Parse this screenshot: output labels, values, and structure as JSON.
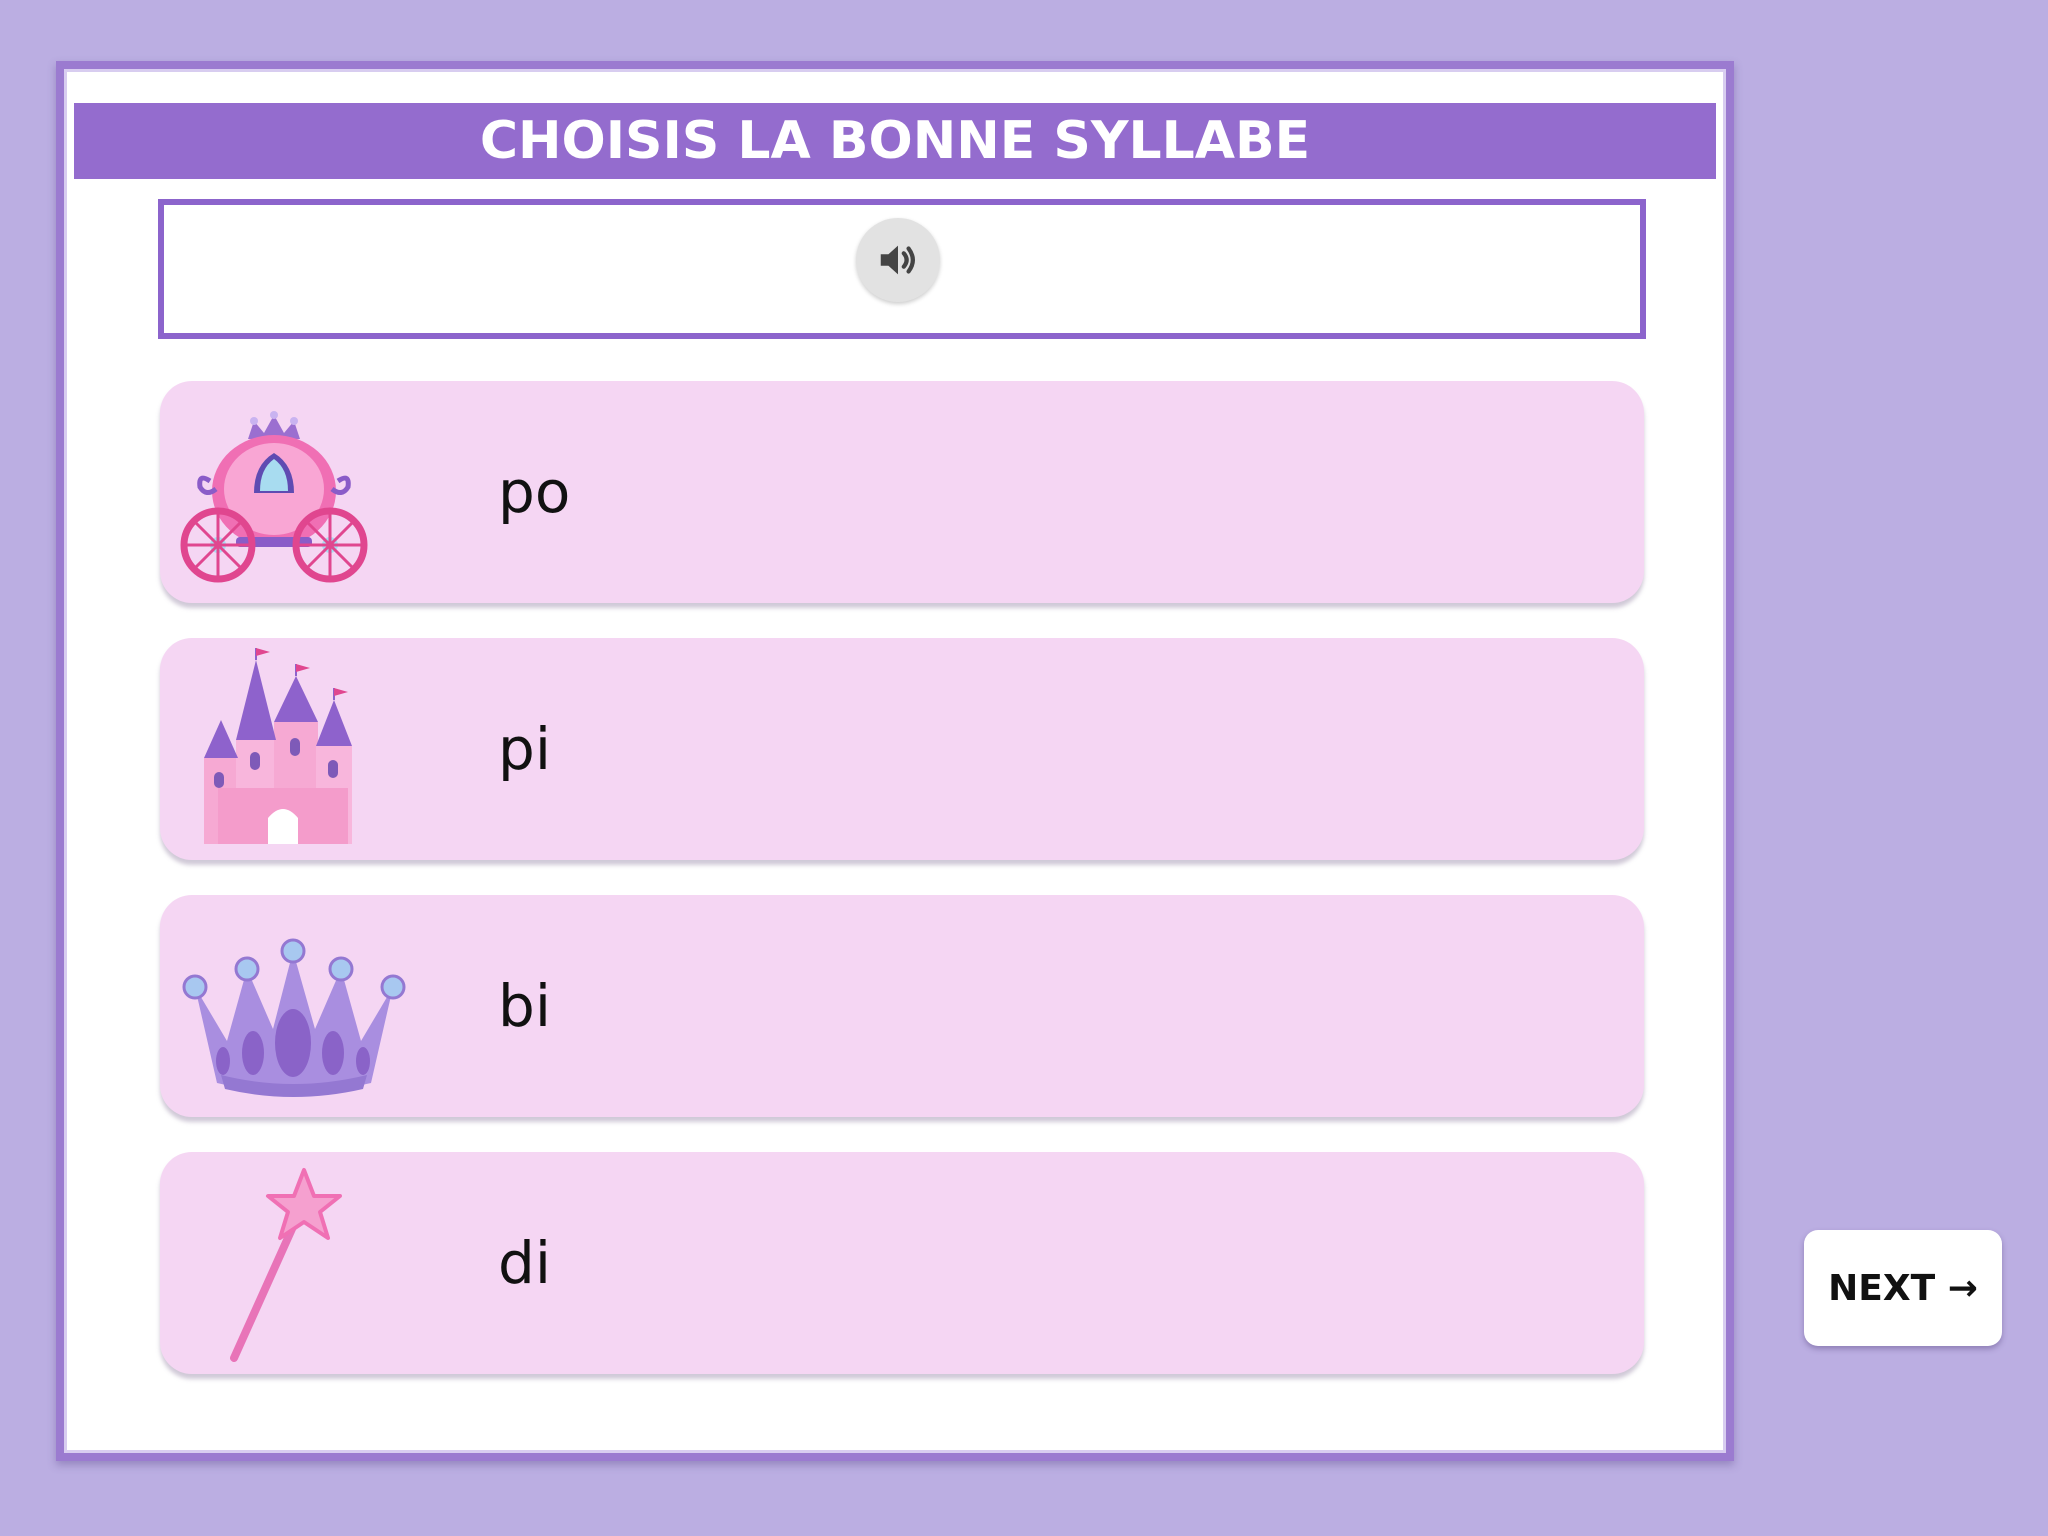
{
  "title": "CHOISIS LA BONNE SYLLABE",
  "audio_button": {
    "icon": "speaker-icon"
  },
  "options": [
    {
      "icon": "carriage-icon",
      "label": "po"
    },
    {
      "icon": "castle-icon",
      "label": "pi"
    },
    {
      "icon": "crown-icon",
      "label": "bi"
    },
    {
      "icon": "magic-wand-icon",
      "label": "di"
    }
  ],
  "next_button": {
    "label": "NEXT →"
  },
  "colors": {
    "background": "#bbaee2",
    "title_bar": "#946cce",
    "option_card": "#f5d6f3",
    "border": "#8c64cc"
  }
}
